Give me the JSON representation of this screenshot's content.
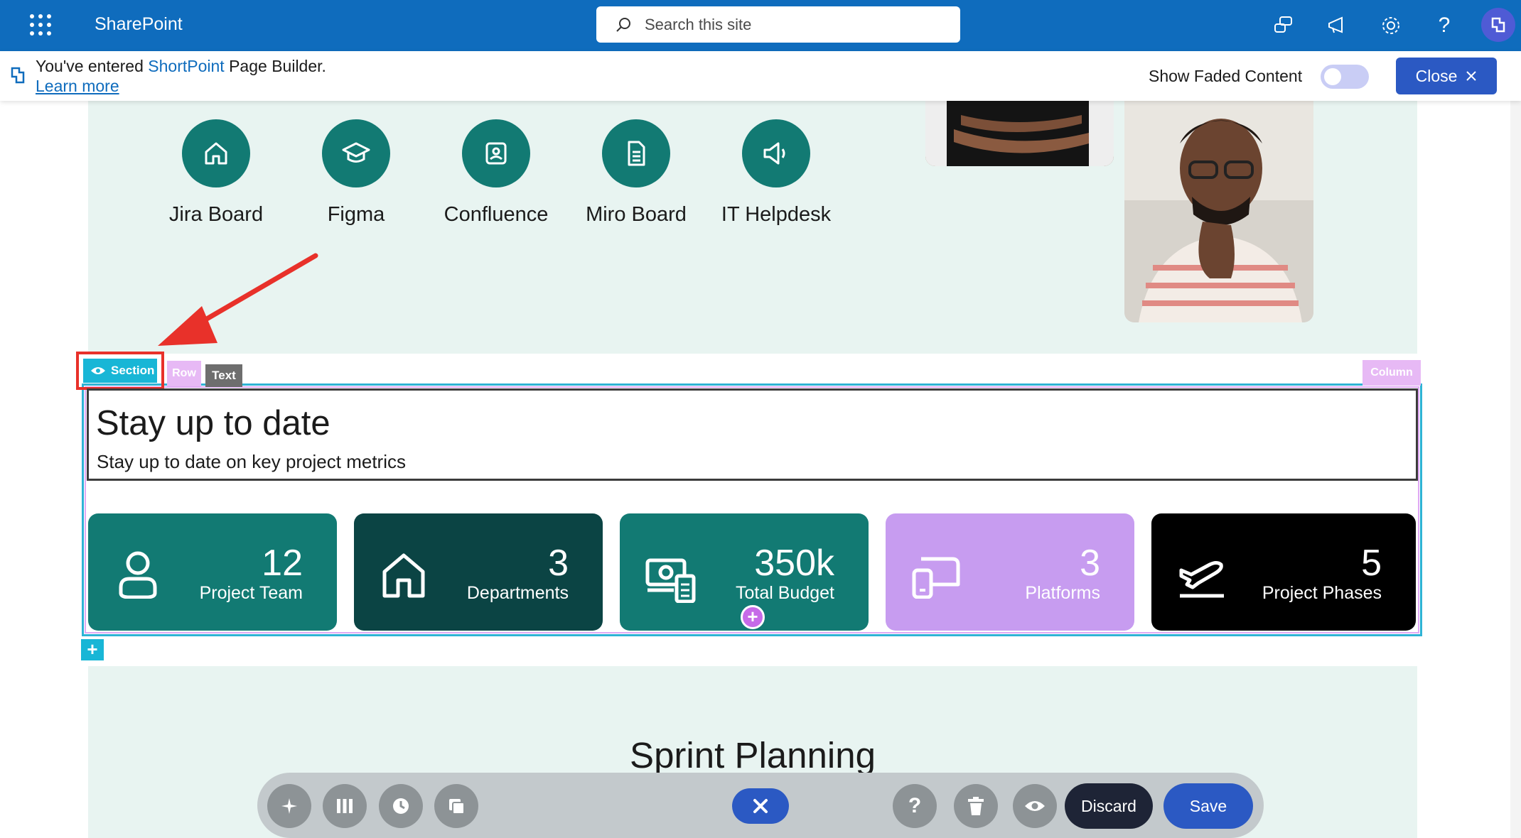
{
  "header": {
    "app_name": "SharePoint",
    "search_placeholder": "Search this site"
  },
  "banner": {
    "message_prefix": "You've entered ",
    "message_accent": "ShortPoint",
    "message_suffix": " Page Builder.",
    "learn_more": "Learn more",
    "show_faded_label": "Show Faded Content",
    "show_faded_on": false,
    "close_label": "Close"
  },
  "apps": [
    {
      "label": "Jira Board",
      "icon": "home-icon"
    },
    {
      "label": "Figma",
      "icon": "graduation-cap-icon"
    },
    {
      "label": "Confluence",
      "icon": "id-card-icon"
    },
    {
      "label": "Miro Board",
      "icon": "document-icon"
    },
    {
      "label": "IT Helpdesk",
      "icon": "megaphone-icon"
    }
  ],
  "editor_tags": {
    "section": "Section",
    "row": "Row",
    "text": "Text",
    "column": "Column"
  },
  "text_block": {
    "heading": "Stay up to date",
    "subtext": "Stay up to date on key project metrics"
  },
  "stats": [
    {
      "value": "12",
      "label": "Project Team",
      "icon": "person-icon",
      "color": "#127a73"
    },
    {
      "value": "3",
      "label": "Departments",
      "icon": "house-icon",
      "color": "#0b4444"
    },
    {
      "value": "350k",
      "label": "Total Budget",
      "icon": "money-calculator-icon",
      "color": "#127a73"
    },
    {
      "value": "3",
      "label": "Platforms",
      "icon": "devices-icon",
      "color": "#c79cf0"
    },
    {
      "value": "5",
      "label": "Project Phases",
      "icon": "airplane-icon",
      "color": "#000000"
    }
  ],
  "lower_section": {
    "title": "Sprint Planning"
  },
  "toolbar": {
    "discard_label": "Discard",
    "save_label": "Save"
  },
  "colors": {
    "suite_bar": "#0f6cbd",
    "teal": "#127a73",
    "section_highlight": "#e8312a",
    "primary_button": "#2b59c3"
  }
}
